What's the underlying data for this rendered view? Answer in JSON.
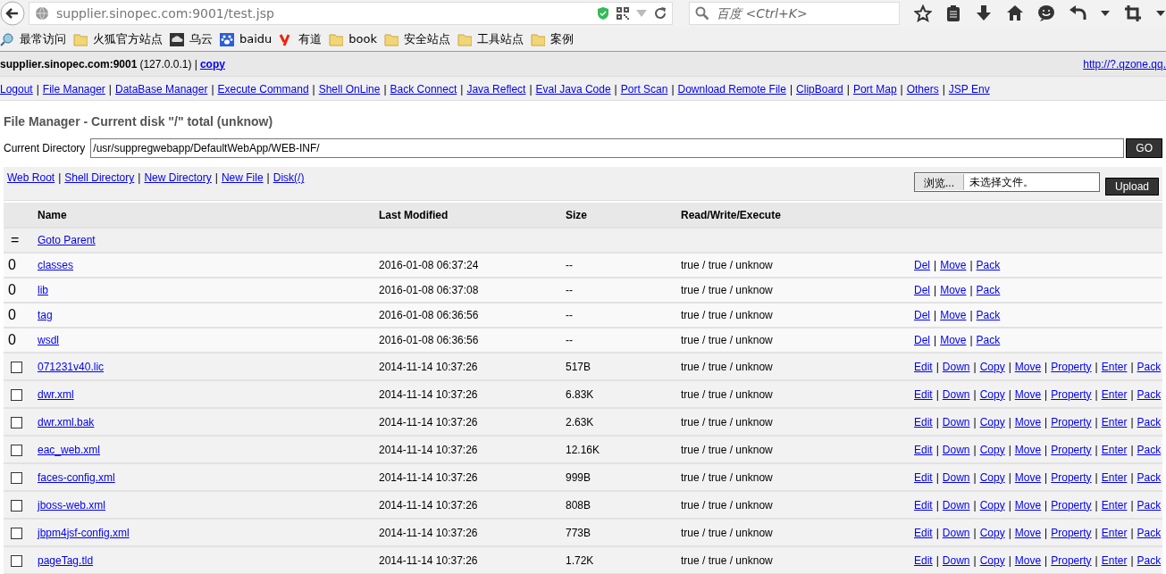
{
  "browser": {
    "url": "supplier.sinopec.com:9001/test.jsp",
    "search": {
      "placeholder": "百度 <Ctrl+K>"
    }
  },
  "bookmarks": [
    {
      "label": "最常访问",
      "kind": "search"
    },
    {
      "label": "火狐官方站点",
      "kind": "folder"
    },
    {
      "label": "乌云",
      "kind": "cloud"
    },
    {
      "label": "baidu",
      "kind": "paw"
    },
    {
      "label": "有道",
      "kind": "y"
    },
    {
      "label": "book",
      "kind": "folder"
    },
    {
      "label": "安全站点",
      "kind": "folder"
    },
    {
      "label": "工具站点",
      "kind": "folder"
    },
    {
      "label": "案例",
      "kind": "folder"
    }
  ],
  "header": {
    "host": "supplier.sinopec.com:9001",
    "ip": "(127.0.0.1) |",
    "copy": "copy",
    "link": "http://?.qzone.qq."
  },
  "nav": [
    "Logout",
    "|",
    "File Manager",
    "|",
    "DataBase Manager",
    "|",
    "Execute Command",
    "|",
    "Shell OnLine",
    "|",
    "Back Connect",
    "|",
    "Java Reflect",
    "|",
    "Eval Java Code",
    "|",
    "Port Scan",
    "|",
    "Download Remote File",
    "|",
    "ClipBoard",
    "|",
    "Port Map",
    "|",
    "Others",
    "|",
    "JSP Env"
  ],
  "title": "File Manager - Current disk \"/\" total (unknow)",
  "directory": {
    "label": "Current Directory",
    "value": "/usr/suppregwebapp/DefaultWebApp/WEB-INF/",
    "button": "GO"
  },
  "tools": [
    "Web Root",
    "|",
    "Shell Directory",
    "|",
    "New Directory",
    "|",
    "New File",
    "|",
    "Disk(/)"
  ],
  "upload": {
    "browse": "浏览...",
    "status": "未选择文件。",
    "button": "Upload"
  },
  "table": {
    "columns": [
      "Name",
      "Last Modified",
      "Size",
      "Read/Write/Execute"
    ],
    "rows": [
      {
        "kind": "parent",
        "marker": "=",
        "name": "Goto Parent"
      },
      {
        "kind": "dir",
        "marker": "0",
        "name": "classes",
        "modified": "2016-01-08 06:37:24",
        "size": "--",
        "rwx": "true / true / unknow",
        "actions": [
          "Del",
          "|",
          "Move",
          "|",
          "Pack"
        ]
      },
      {
        "kind": "dir",
        "marker": "0",
        "name": "lib",
        "modified": "2016-01-08 06:37:08",
        "size": "--",
        "rwx": "true / true / unknow",
        "actions": [
          "Del",
          "|",
          "Move",
          "|",
          "Pack"
        ]
      },
      {
        "kind": "dir",
        "marker": "0",
        "name": "tag",
        "modified": "2016-01-08 06:36:56",
        "size": "--",
        "rwx": "true / true / unknow",
        "actions": [
          "Del",
          "|",
          "Move",
          "|",
          "Pack"
        ]
      },
      {
        "kind": "dir",
        "marker": "0",
        "name": "wsdl",
        "modified": "2016-01-08 06:36:56",
        "size": "--",
        "rwx": "true / true / unknow",
        "actions": [
          "Del",
          "|",
          "Move",
          "|",
          "Pack"
        ]
      },
      {
        "kind": "file",
        "checked": false,
        "name": "071231v40.lic",
        "modified": "2014-11-14 10:37:26",
        "size": "517B",
        "rwx": "true / true / unknow",
        "actions": [
          "Edit",
          "|",
          "Down",
          "|",
          "Copy",
          "|",
          "Move",
          "|",
          "Property",
          "|",
          "Enter",
          "|",
          "Pack"
        ]
      },
      {
        "kind": "file",
        "checked": false,
        "name": "dwr.xml",
        "modified": "2014-11-14 10:37:26",
        "size": "6.83K",
        "rwx": "true / true / unknow",
        "actions": [
          "Edit",
          "|",
          "Down",
          "|",
          "Copy",
          "|",
          "Move",
          "|",
          "Property",
          "|",
          "Enter",
          "|",
          "Pack"
        ]
      },
      {
        "kind": "file",
        "checked": false,
        "name": "dwr.xml.bak",
        "modified": "2014-11-14 10:37:26",
        "size": "2.63K",
        "rwx": "true / true / unknow",
        "actions": [
          "Edit",
          "|",
          "Down",
          "|",
          "Copy",
          "|",
          "Move",
          "|",
          "Property",
          "|",
          "Enter",
          "|",
          "Pack"
        ]
      },
      {
        "kind": "file",
        "checked": false,
        "name": "eac_web.xml",
        "modified": "2014-11-14 10:37:26",
        "size": "12.16K",
        "rwx": "true / true / unknow",
        "actions": [
          "Edit",
          "|",
          "Down",
          "|",
          "Copy",
          "|",
          "Move",
          "|",
          "Property",
          "|",
          "Enter",
          "|",
          "Pack"
        ]
      },
      {
        "kind": "file",
        "checked": false,
        "name": "faces-config.xml",
        "modified": "2014-11-14 10:37:26",
        "size": "999B",
        "rwx": "true / true / unknow",
        "actions": [
          "Edit",
          "|",
          "Down",
          "|",
          "Copy",
          "|",
          "Move",
          "|",
          "Property",
          "|",
          "Enter",
          "|",
          "Pack"
        ]
      },
      {
        "kind": "file",
        "checked": false,
        "name": "jboss-web.xml",
        "modified": "2014-11-14 10:37:26",
        "size": "808B",
        "rwx": "true / true / unknow",
        "actions": [
          "Edit",
          "|",
          "Down",
          "|",
          "Copy",
          "|",
          "Move",
          "|",
          "Property",
          "|",
          "Enter",
          "|",
          "Pack"
        ]
      },
      {
        "kind": "file",
        "checked": false,
        "name": "jbpm4jsf-config.xml",
        "modified": "2014-11-14 10:37:26",
        "size": "773B",
        "rwx": "true / true / unknow",
        "actions": [
          "Edit",
          "|",
          "Down",
          "|",
          "Copy",
          "|",
          "Move",
          "|",
          "Property",
          "|",
          "Enter",
          "|",
          "Pack"
        ]
      },
      {
        "kind": "file",
        "checked": false,
        "name": "pageTag.tld",
        "modified": "2014-11-14 10:37:26",
        "size": "1.72K",
        "rwx": "true / true / unknow",
        "actions": [
          "Edit",
          "|",
          "Down",
          "|",
          "Copy",
          "|",
          "Move",
          "|",
          "Property",
          "|",
          "Enter",
          "|",
          "Pack"
        ]
      }
    ]
  }
}
